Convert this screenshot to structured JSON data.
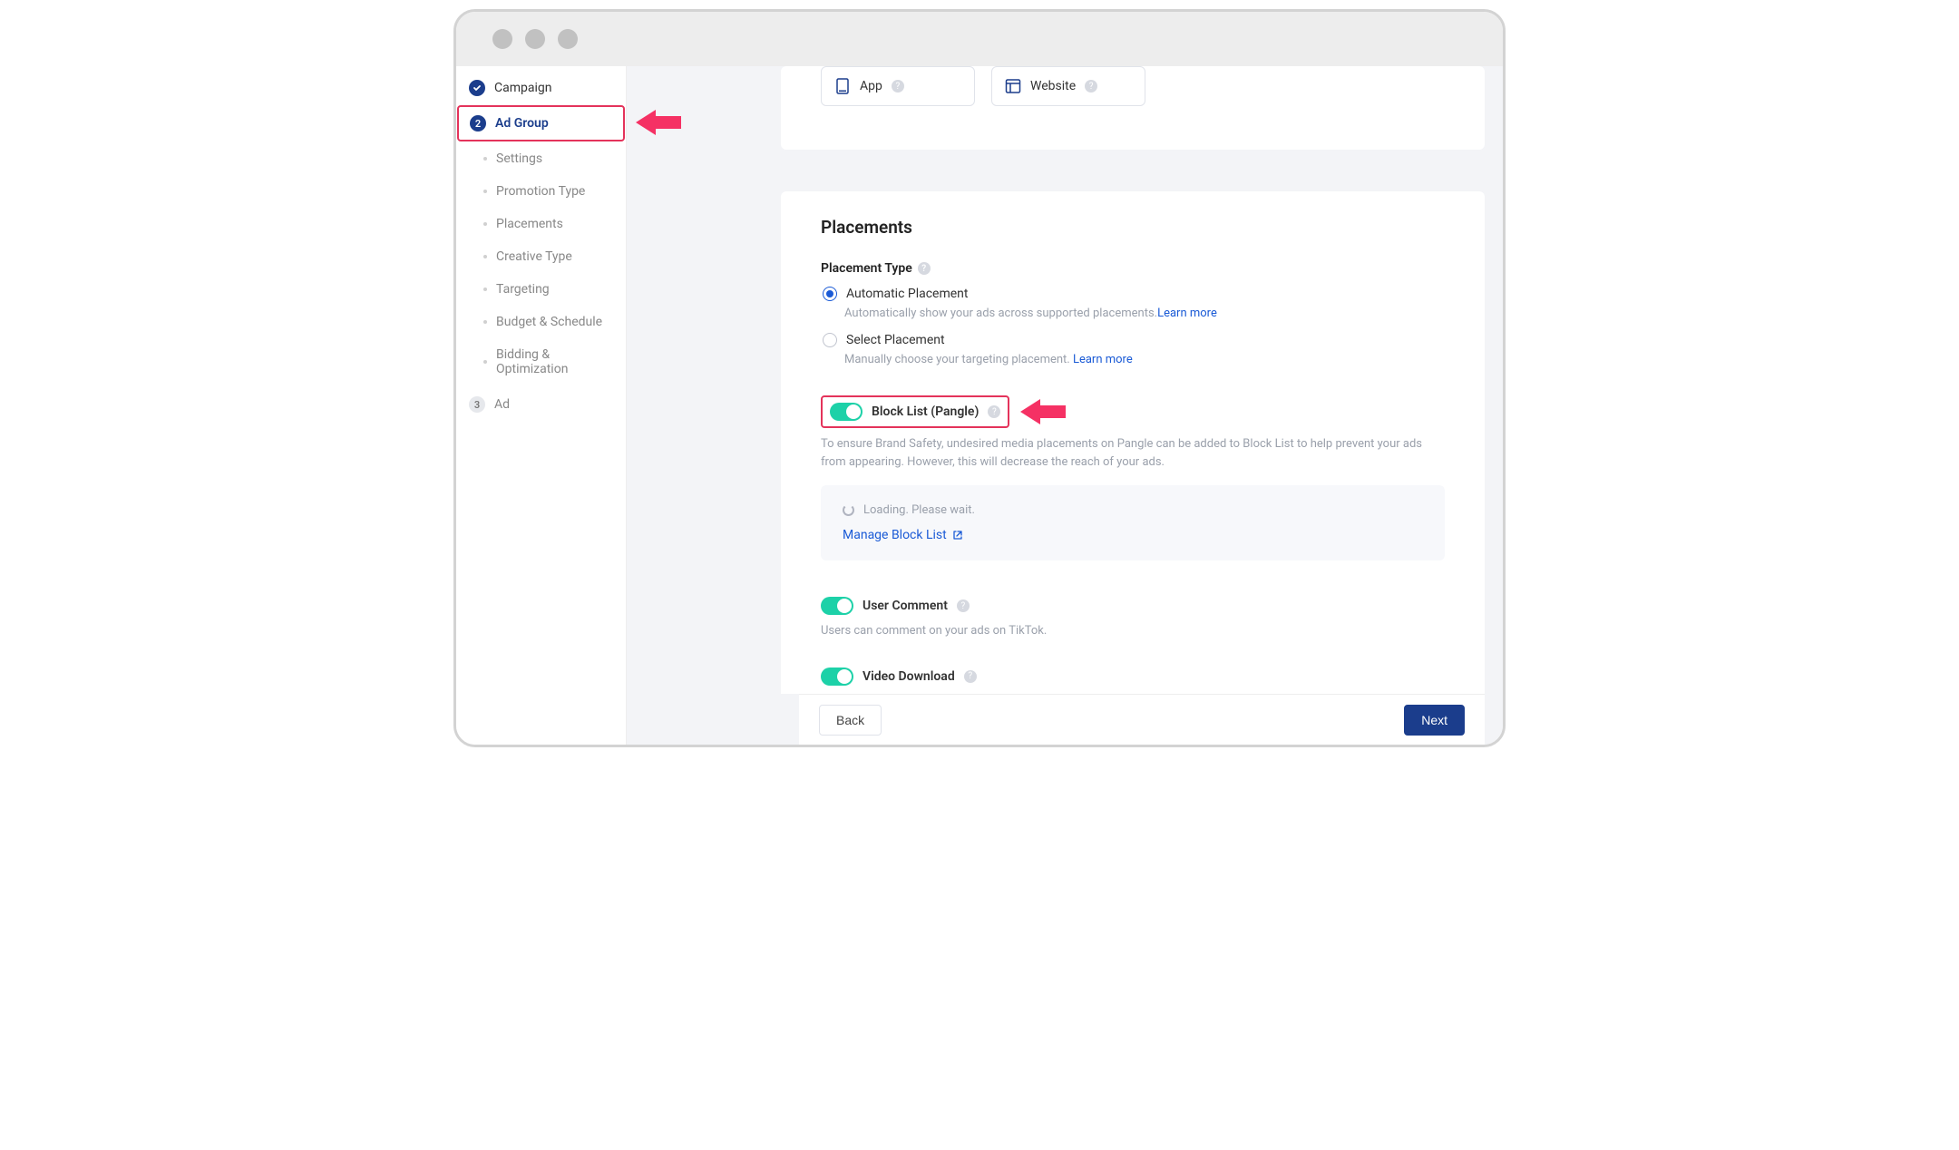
{
  "sidebar": {
    "stepCampaign": "Campaign",
    "stepAdGroupNumber": "2",
    "stepAdGroup": "Ad Group",
    "subs": {
      "settings": "Settings",
      "promotionType": "Promotion Type",
      "placements": "Placements",
      "creativeType": "Creative Type",
      "targeting": "Targeting",
      "budget": "Budget & Schedule",
      "bidding": "Bidding & Optimization"
    },
    "stepAdNumber": "3",
    "stepAd": "Ad"
  },
  "promo": {
    "app": "App",
    "website": "Website"
  },
  "placements": {
    "title": "Placements",
    "typeLabel": "Placement Type",
    "auto": {
      "label": "Automatic Placement",
      "desc": "Automatically show your ads across supported placements.",
      "learn": "Learn more"
    },
    "select": {
      "label": "Select Placement",
      "desc": "Manually choose your targeting placement. ",
      "learn": "Learn more"
    },
    "blockList": {
      "label": "Block List (Pangle)",
      "desc": "To ensure Brand Safety, undesired media placements on Pangle can be added to Block List to help prevent your ads from appearing. However, this will decrease the reach of your ads.",
      "loading": "Loading. Please wait.",
      "manage": "Manage Block List"
    },
    "userComment": {
      "label": "User Comment",
      "desc": "Users can comment on your ads on TikTok."
    },
    "videoDownload": {
      "label": "Video Download"
    }
  },
  "footer": {
    "back": "Back",
    "next": "Next"
  }
}
